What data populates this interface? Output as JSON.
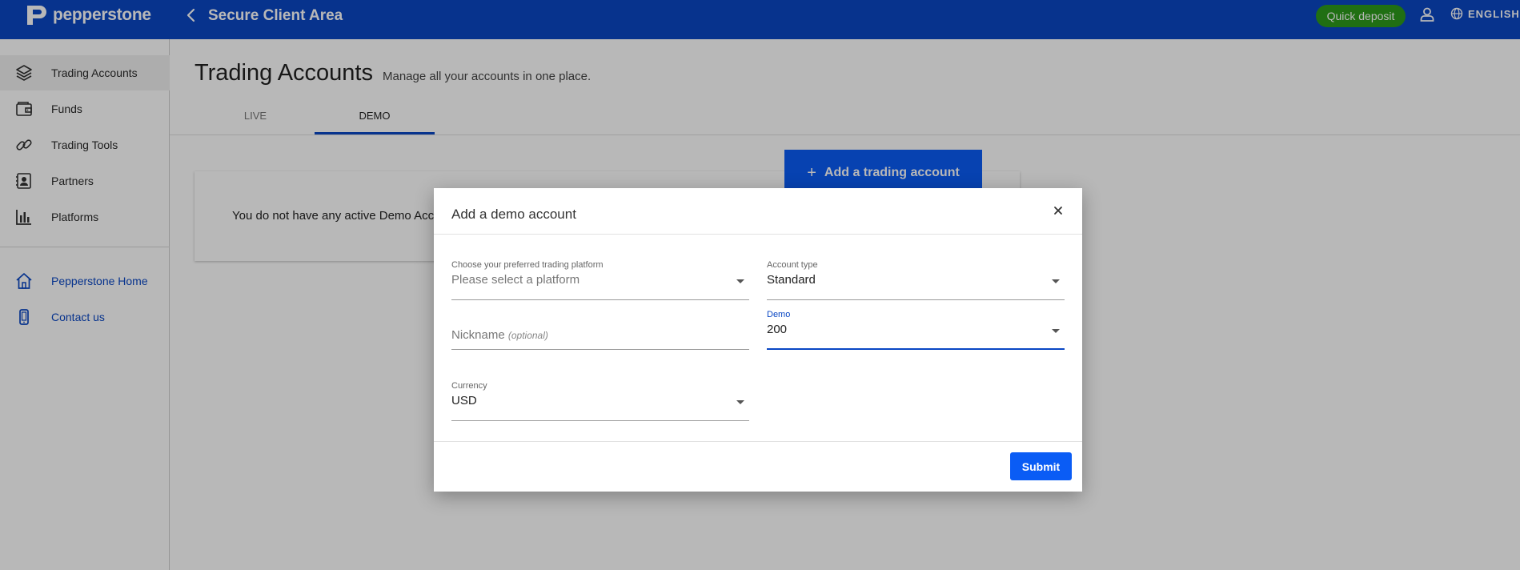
{
  "header": {
    "brand": "pepperstone",
    "title": "Secure Client Area",
    "quick_deposit": "Quick deposit",
    "language": "ENGLISH",
    "brand_color": "#0a47c4"
  },
  "sidebar": {
    "items": [
      {
        "label": "Trading Accounts",
        "icon": "layers-icon",
        "active": true
      },
      {
        "label": "Funds",
        "icon": "wallet-icon"
      },
      {
        "label": "Trading Tools",
        "icon": "link-icon"
      },
      {
        "label": "Partners",
        "icon": "contacts-icon"
      },
      {
        "label": "Platforms",
        "icon": "bar-chart-icon"
      }
    ],
    "links": [
      {
        "label": "Pepperstone Home",
        "icon": "home-icon"
      },
      {
        "label": "Contact us",
        "icon": "phone-icon"
      }
    ]
  },
  "main": {
    "title": "Trading Accounts",
    "subtitle": "Manage all your accounts in one place.",
    "tabs": [
      {
        "label": "LIVE",
        "active": false
      },
      {
        "label": "DEMO",
        "active": true
      }
    ],
    "add_button": "Add a trading account",
    "empty_message": "You do not have any active Demo Acco"
  },
  "modal": {
    "title": "Add a demo account",
    "fields": {
      "platform": {
        "label": "Choose your preferred trading platform",
        "placeholder": "Please select a platform"
      },
      "account_type": {
        "label": "Account type",
        "value": "Standard"
      },
      "nickname": {
        "placeholder": "Nickname",
        "optional": "(optional)"
      },
      "demo": {
        "label": "Demo",
        "value": "200"
      },
      "currency": {
        "label": "Currency",
        "value": "USD"
      }
    },
    "submit": "Submit"
  }
}
